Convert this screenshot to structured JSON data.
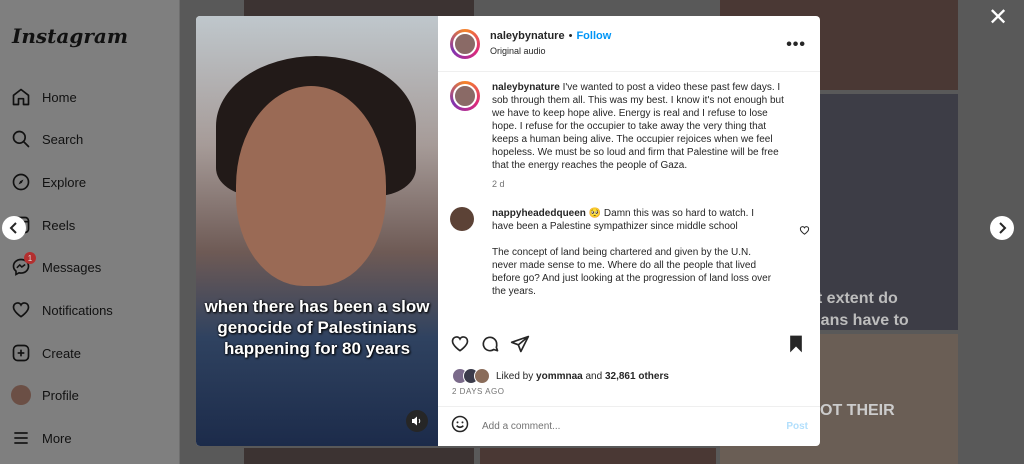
{
  "sidebar": {
    "logo": "Instagram",
    "items": [
      {
        "label": "Home",
        "icon": "home-icon"
      },
      {
        "label": "Search",
        "icon": "search-icon"
      },
      {
        "label": "Explore",
        "icon": "compass-icon"
      },
      {
        "label": "Reels",
        "icon": "reels-icon"
      },
      {
        "label": "Messages",
        "icon": "messenger-icon",
        "badge": "1"
      },
      {
        "label": "Notifications",
        "icon": "heart-icon"
      },
      {
        "label": "Create",
        "icon": "plus-square-icon"
      },
      {
        "label": "Profile",
        "icon": "avatar"
      },
      {
        "label": "More",
        "icon": "menu-icon"
      }
    ]
  },
  "background": {
    "overlay_texts": [
      "at extent do",
      "inians have to",
      "OT THEIR"
    ]
  },
  "video": {
    "caption": "when there has been a slow genocide of Palestinians happening for 80 years"
  },
  "post": {
    "author": "naleybynature",
    "separator": "•",
    "follow_label": "Follow",
    "audio": "Original audio",
    "more_label": "•••",
    "caption_text": "I've wanted to post a video these past few days. I sob through them all. This was my best. I know it's not enough but we have to keep hope alive. Energy is real and I refuse to lose hope. I refuse for the occupier to take away the very thing that keeps a human being alive. The occupier rejoices when we feel hopeless. We must be so loud and firm that Palestine will be free that the energy reaches the people of Gaza.",
    "caption_time": "2 d",
    "comments": [
      {
        "author": "nappyheadedqueen",
        "emoji": "🥺",
        "text_1": "Damn this was so hard to watch. I have been a Palestine sympathizer since middle school",
        "text_2": "The concept of land being chartered and given by the U.N. never made sense to me. Where do all the people that lived before go? And just looking at the progression of land loss over the years."
      }
    ],
    "liked_prefix": "Liked by",
    "liked_user": "yommnaa",
    "liked_middle": "and",
    "liked_count": "32,861 others",
    "date": "2 DAYS AGO",
    "comment_placeholder": "Add a comment...",
    "post_label": "Post"
  },
  "close_label": "✕"
}
